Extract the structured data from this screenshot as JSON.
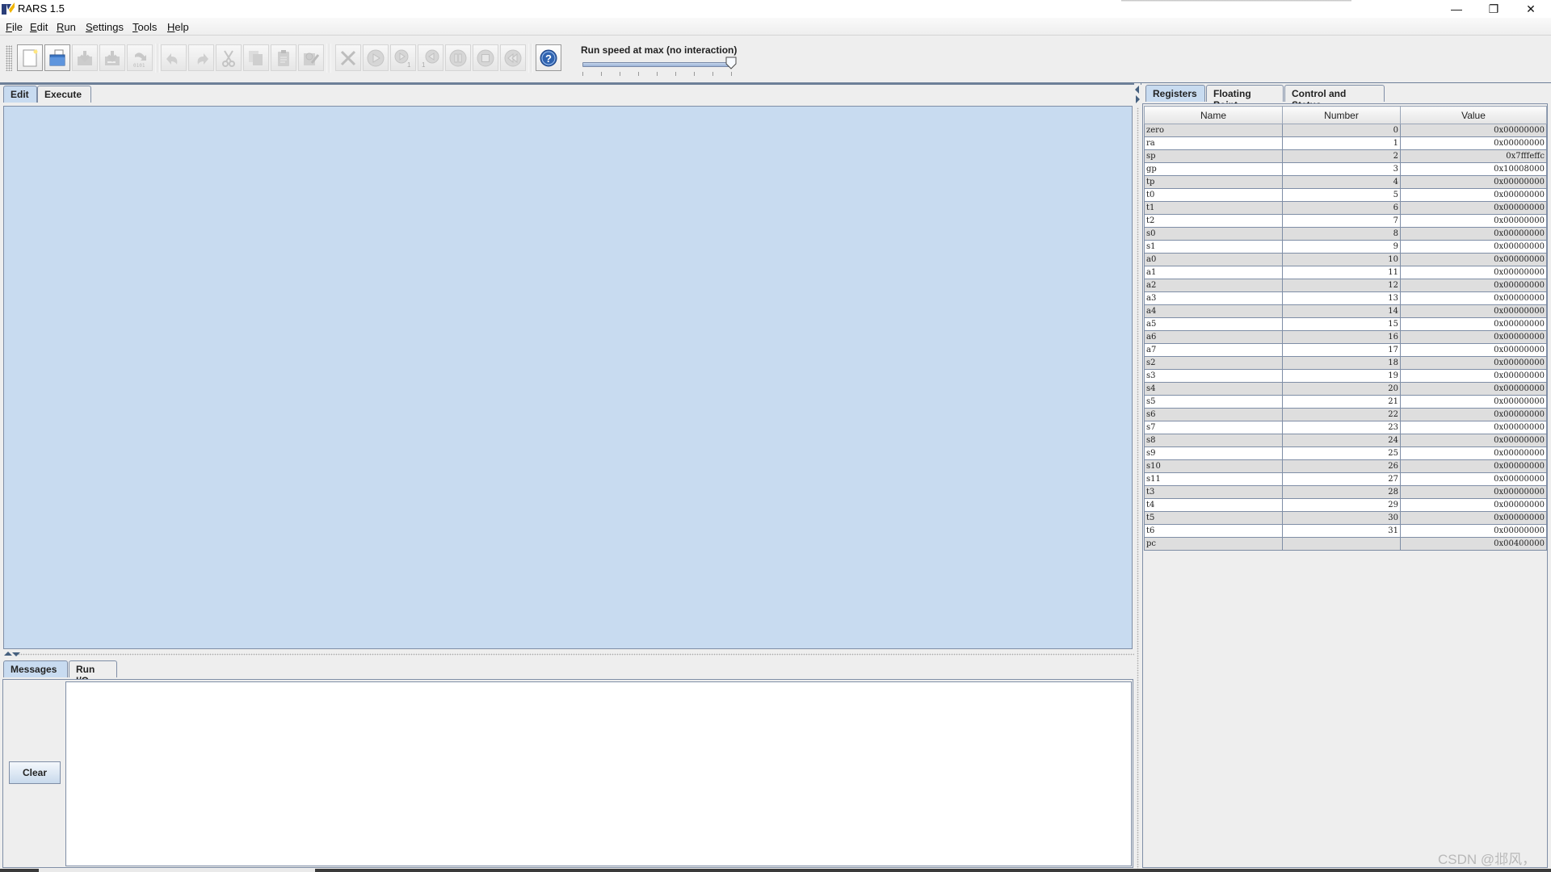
{
  "window": {
    "title": "RARS 1.5",
    "controls": {
      "minimize": "—",
      "maximize": "❐",
      "close": "✕"
    }
  },
  "menu": [
    "File",
    "Edit",
    "Run",
    "Settings",
    "Tools",
    "Help"
  ],
  "toolbar": {
    "buttons": [
      {
        "name": "new-file",
        "icon": "new-file-icon",
        "enabled": true
      },
      {
        "name": "open-file",
        "icon": "folder-open-icon",
        "enabled": true
      },
      {
        "name": "save",
        "icon": "save-icon",
        "enabled": false
      },
      {
        "name": "save-as",
        "icon": "save-as-icon",
        "enabled": false
      },
      {
        "name": "dump-memory",
        "icon": "dump-icon",
        "enabled": false,
        "caption": "0101"
      },
      {
        "name": "undo",
        "icon": "undo-icon",
        "enabled": false
      },
      {
        "name": "redo",
        "icon": "redo-icon",
        "enabled": false
      },
      {
        "name": "cut",
        "icon": "scissors-icon",
        "enabled": false
      },
      {
        "name": "copy",
        "icon": "copy-icon",
        "enabled": false
      },
      {
        "name": "paste",
        "icon": "clipboard-icon",
        "enabled": false
      },
      {
        "name": "find-replace",
        "icon": "find-replace-icon",
        "enabled": false
      },
      {
        "name": "assemble",
        "icon": "wrench-screwdriver-icon",
        "enabled": false
      },
      {
        "name": "run",
        "icon": "play-icon",
        "enabled": false
      },
      {
        "name": "step",
        "icon": "step-forward-icon",
        "enabled": false,
        "caption": "1"
      },
      {
        "name": "backstep",
        "icon": "step-back-icon",
        "enabled": false,
        "caption": "1"
      },
      {
        "name": "pause",
        "icon": "pause-icon",
        "enabled": false
      },
      {
        "name": "stop",
        "icon": "stop-icon",
        "enabled": false
      },
      {
        "name": "reset",
        "icon": "rewind-icon",
        "enabled": false
      },
      {
        "name": "help",
        "icon": "help-icon",
        "enabled": true
      }
    ],
    "speed_label": "Run speed at max (no interaction)",
    "speed_value_fraction": 1.0
  },
  "editor_tabs": [
    {
      "label": "Edit",
      "selected": true
    },
    {
      "label": "Execute",
      "selected": false
    }
  ],
  "messages_tabs": [
    {
      "label": "Messages",
      "selected": true
    },
    {
      "label": "Run I/O",
      "selected": false
    }
  ],
  "messages": {
    "clear_label": "Clear",
    "content": ""
  },
  "register_tabs": [
    {
      "label": "Registers",
      "selected": true
    },
    {
      "label": "Floating Point",
      "selected": false
    },
    {
      "label": "Control and Status",
      "selected": false
    }
  ],
  "registers": {
    "columns": [
      "Name",
      "Number",
      "Value"
    ],
    "rows": [
      {
        "name": "zero",
        "number": "0",
        "value": "0x00000000"
      },
      {
        "name": "ra",
        "number": "1",
        "value": "0x00000000"
      },
      {
        "name": "sp",
        "number": "2",
        "value": "0x7fffeffc"
      },
      {
        "name": "gp",
        "number": "3",
        "value": "0x10008000"
      },
      {
        "name": "tp",
        "number": "4",
        "value": "0x00000000"
      },
      {
        "name": "t0",
        "number": "5",
        "value": "0x00000000"
      },
      {
        "name": "t1",
        "number": "6",
        "value": "0x00000000"
      },
      {
        "name": "t2",
        "number": "7",
        "value": "0x00000000"
      },
      {
        "name": "s0",
        "number": "8",
        "value": "0x00000000"
      },
      {
        "name": "s1",
        "number": "9",
        "value": "0x00000000"
      },
      {
        "name": "a0",
        "number": "10",
        "value": "0x00000000"
      },
      {
        "name": "a1",
        "number": "11",
        "value": "0x00000000"
      },
      {
        "name": "a2",
        "number": "12",
        "value": "0x00000000"
      },
      {
        "name": "a3",
        "number": "13",
        "value": "0x00000000"
      },
      {
        "name": "a4",
        "number": "14",
        "value": "0x00000000"
      },
      {
        "name": "a5",
        "number": "15",
        "value": "0x00000000"
      },
      {
        "name": "a6",
        "number": "16",
        "value": "0x00000000"
      },
      {
        "name": "a7",
        "number": "17",
        "value": "0x00000000"
      },
      {
        "name": "s2",
        "number": "18",
        "value": "0x00000000"
      },
      {
        "name": "s3",
        "number": "19",
        "value": "0x00000000"
      },
      {
        "name": "s4",
        "number": "20",
        "value": "0x00000000"
      },
      {
        "name": "s5",
        "number": "21",
        "value": "0x00000000"
      },
      {
        "name": "s6",
        "number": "22",
        "value": "0x00000000"
      },
      {
        "name": "s7",
        "number": "23",
        "value": "0x00000000"
      },
      {
        "name": "s8",
        "number": "24",
        "value": "0x00000000"
      },
      {
        "name": "s9",
        "number": "25",
        "value": "0x00000000"
      },
      {
        "name": "s10",
        "number": "26",
        "value": "0x00000000"
      },
      {
        "name": "s11",
        "number": "27",
        "value": "0x00000000"
      },
      {
        "name": "t3",
        "number": "28",
        "value": "0x00000000"
      },
      {
        "name": "t4",
        "number": "29",
        "value": "0x00000000"
      },
      {
        "name": "t5",
        "number": "30",
        "value": "0x00000000"
      },
      {
        "name": "t6",
        "number": "31",
        "value": "0x00000000"
      },
      {
        "name": "pc",
        "number": "",
        "value": "0x00400000"
      }
    ]
  },
  "watermark": "CSDN @邶风，",
  "colors": {
    "selected_tab": "#c8dbf0",
    "editor_bg": "#c8dbf0",
    "border": "#7f8ea6",
    "row_odd": "#dedede",
    "row_even": "#ffffff"
  }
}
